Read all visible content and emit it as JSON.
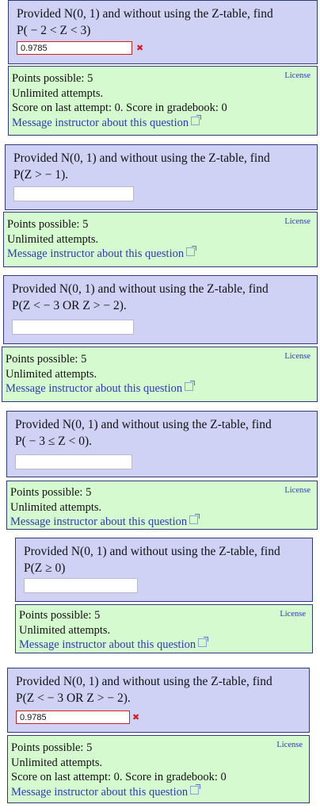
{
  "colors": {
    "question_bg": "#cfd1f5",
    "info_bg": "#d6fad0",
    "border": "#2f3a78",
    "link": "#2e3ab5",
    "error": "#d32020"
  },
  "questions": [
    {
      "prefix": "Provided",
      "dist": "N(0, 1)",
      "suffix": "and without using the Z-table, find",
      "expr": "P( − 2 < Z < 3)",
      "answer_value": "0.9785",
      "answer_state": "wrong",
      "points": "Points possible: 5",
      "attempts": "Unlimited attempts.",
      "score": "Score on last attempt: 0. Score in gradebook: 0",
      "message": "Message instructor about this question",
      "license": "License"
    },
    {
      "prefix": "Provided",
      "dist": "N(0, 1)",
      "suffix": "and without using the Z-table, find",
      "expr": "P(Z > − 1).",
      "answer_value": "",
      "answer_state": "blank",
      "points": "Points possible: 5",
      "attempts": "Unlimited attempts.",
      "message": "Message instructor about this question",
      "license": "License"
    },
    {
      "prefix": "Provided",
      "dist": "N(0, 1)",
      "suffix": "and without using the Z-table, find",
      "expr": "P(Z < − 3 OR Z > − 2).",
      "answer_value": "",
      "answer_state": "blank",
      "points": "Points possible: 5",
      "attempts": "Unlimited attempts.",
      "message": "Message instructor about this question",
      "license": "License"
    },
    {
      "prefix": "Provided",
      "dist": "N(0, 1)",
      "suffix": "and without using the Z-table, find",
      "expr": "P( − 3 ≤ Z < 0).",
      "answer_value": "",
      "answer_state": "blank",
      "points": "Points possible: 5",
      "attempts": "Unlimited attempts.",
      "message": "Message instructor about this question",
      "license": "License"
    },
    {
      "prefix": "Provided",
      "dist": "N(0, 1)",
      "suffix": "and without using the Z-table, find",
      "expr": "P(Z ≥ 0)",
      "answer_value": "",
      "answer_state": "blank",
      "points": "Points possible: 5",
      "attempts": "Unlimited attempts.",
      "message": "Message instructor about this question",
      "license": "License"
    },
    {
      "prefix": "Provided",
      "dist": "N(0, 1)",
      "suffix": "and without using the Z-table, find",
      "expr": "P(Z < − 3 OR Z > − 2).",
      "answer_value": "0.9785",
      "answer_state": "wrong",
      "points": "Points possible: 5",
      "attempts": "Unlimited attempts.",
      "score": "Score on last attempt: 0. Score in gradebook: 0",
      "message": "Message instructor about this question",
      "license": "License"
    }
  ]
}
